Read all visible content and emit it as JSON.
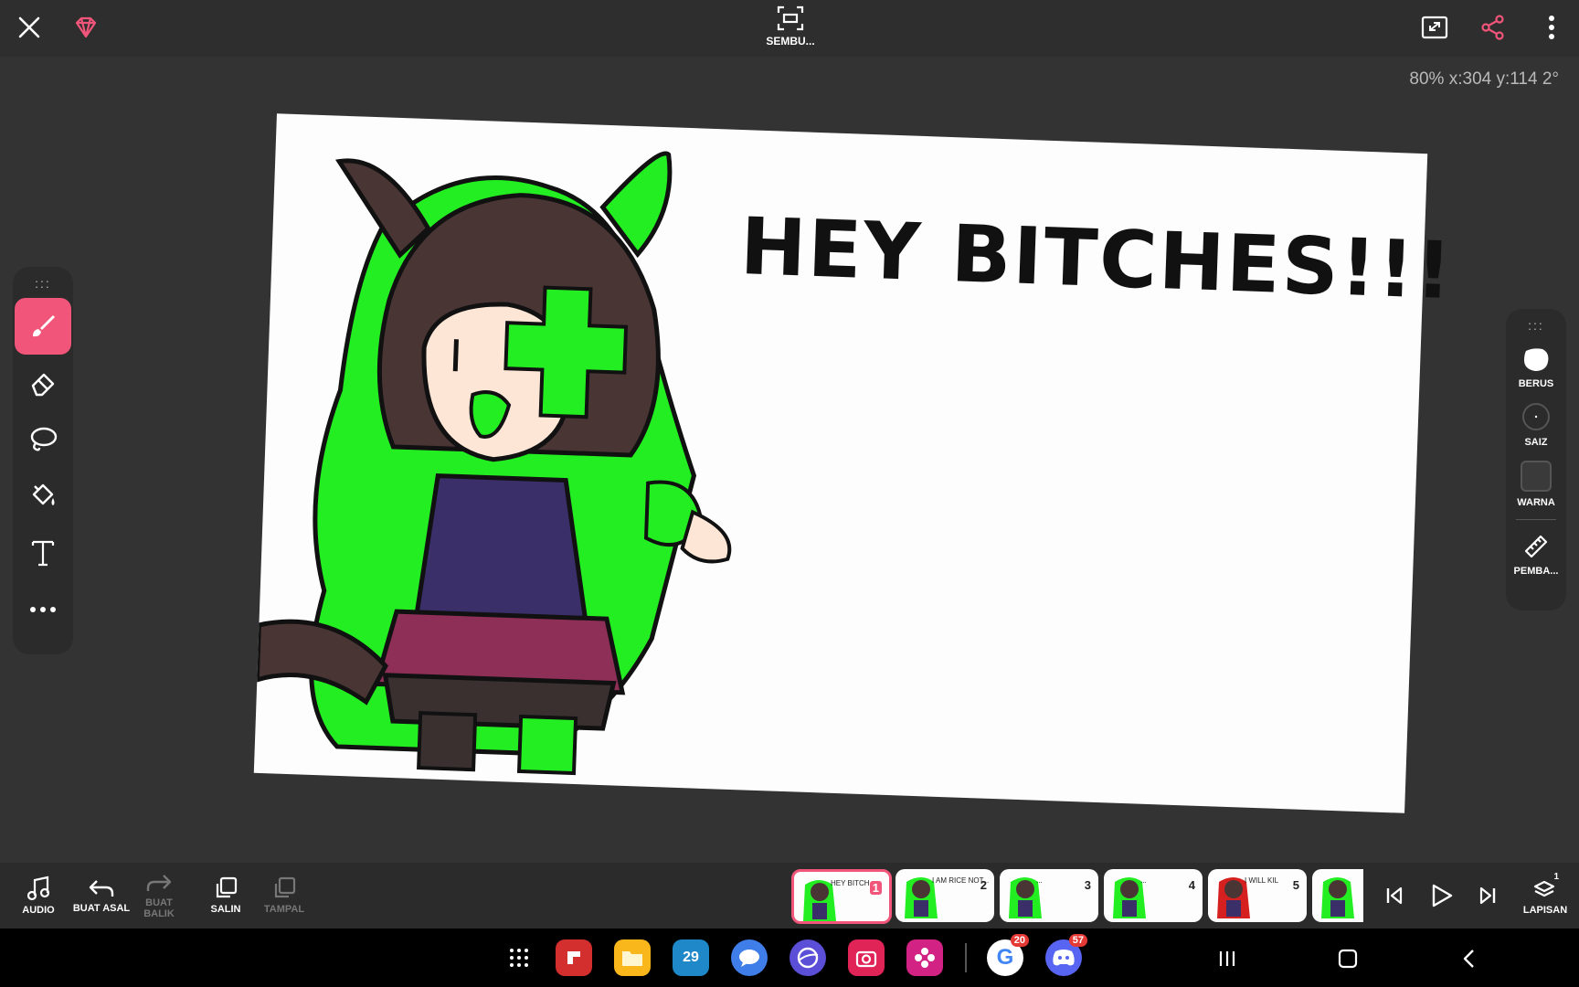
{
  "topbar": {
    "center_label": "SEMBU...",
    "status_readout": "80% x:304 y:114 2°"
  },
  "canvas": {
    "text": "HEY BITCHES!!!"
  },
  "left_toolbar": {
    "tools": [
      "brush-icon",
      "eraser-icon",
      "lasso-icon",
      "fill-icon",
      "text-icon",
      "more-icon"
    ],
    "active": "brush-icon"
  },
  "right_toolbar": {
    "brush_label": "BERUS",
    "size_label": "SAIZ",
    "color_label": "WARNA",
    "ruler_label": "PEMBA...",
    "current_color": "#3a3a3a"
  },
  "bottombar": {
    "audio_label": "AUDIO",
    "undo_label": "BUAT ASAL",
    "redo_label": "BUAT BALIK",
    "copy_label": "SALIN",
    "paste_label": "TAMPAL",
    "layers_label": "LAPISAN",
    "layers_count": "1"
  },
  "frames": [
    {
      "number": "1",
      "caption": "HEY BITCH",
      "active": true
    },
    {
      "number": "2",
      "caption": "I AM RICE NOT...",
      "active": false
    },
    {
      "number": "3",
      "caption": "...",
      "active": false
    },
    {
      "number": "4",
      "caption": "...",
      "active": false
    },
    {
      "number": "5",
      "caption": "I WILL KIL",
      "active": false
    }
  ],
  "navbar": {
    "calendar_day": "29",
    "google_badge": "20",
    "discord_badge": "57"
  },
  "colors": {
    "accent": "#f2557a",
    "toolbar_bg": "#2b2b2b",
    "canvas_bg": "#fdfdfd",
    "character_green": "#22ee22"
  }
}
